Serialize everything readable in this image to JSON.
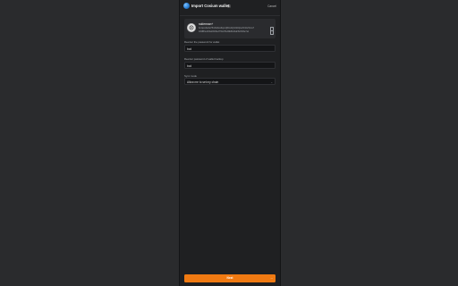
{
  "header": {
    "title": "Import Cosium wallet",
    "badge": "⛓",
    "cancel_label": "Cancel"
  },
  "wallet": {
    "name": "raiderman+",
    "addresses": [
      "bc1qcu0a4w7fhx6d2xw9qnxrj8lmd4yhx9z0pw3zn6u7kms7",
      "0x9fB3e1D4a6Cb8e2f7A0c51d9E6b24aF8c0D3e7a1"
    ]
  },
  "form": {
    "field1_label": "Reenter the password for wallet",
    "field1_value": "bcd",
    "field2_label": "Reenter password of wallet backup",
    "field2_value": "bcd",
    "field3_label": "Sync mode",
    "field3_value": "Allow me to set my chain"
  },
  "footer": {
    "primary_label": "Next"
  },
  "colors": {
    "accent": "#f07a12",
    "panel_bg": "#1f2022",
    "page_bg": "#2a2b2d"
  }
}
